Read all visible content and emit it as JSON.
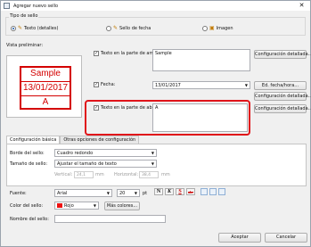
{
  "window": {
    "title": "Agregar nuevo sello",
    "close_glyph": "✕"
  },
  "stamp_type": {
    "label": "Tipo de sello",
    "options": [
      {
        "label": "Texto (detalles)",
        "icon": "text-stamp-icon",
        "glyph": "✎",
        "selected": true
      },
      {
        "label": "Sello de fecha",
        "icon": "date-stamp-icon",
        "glyph": "✎",
        "selected": false
      },
      {
        "label": "Imagen",
        "icon": "image-stamp-icon",
        "glyph": "▣",
        "selected": false
      }
    ]
  },
  "preview": {
    "label": "Vista preliminar:",
    "lines": [
      "Sample",
      "13/01/2017",
      "A"
    ],
    "color": "#d40000"
  },
  "top_text": {
    "checkbox_label": "Texto en la parte de arriba:",
    "checked": true,
    "value": "Sample",
    "detail_button": "Configuración detallada..."
  },
  "date": {
    "checkbox_label": "Fecha:",
    "checked": true,
    "value": "13/01/2017",
    "format_button": "Ed. fecha/hora...",
    "detail_button": "Configuración detallada..."
  },
  "bottom_text": {
    "checkbox_label": "Texto en la parte de abajo:",
    "checked": true,
    "value": "A",
    "detail_button": "Configuración detallada..."
  },
  "tabs": [
    {
      "label": "Configuración básica",
      "active": true
    },
    {
      "label": "Otras opciones de configuración",
      "active": false
    }
  ],
  "basic": {
    "border_label": "Borde del sello:",
    "border_value": "Cuadro redondo",
    "size_label": "Tamaño de sello:",
    "size_value": "Ajustar el tamaño de texto",
    "vertical_label": "Vertical:",
    "vertical_value": "24,1",
    "horizontal_label": "Horizontal:",
    "horizontal_value": "38,4",
    "unit": "mm",
    "font_label": "Fuente:",
    "font_value": "Arial",
    "font_size": "20",
    "font_size_unit": "pt",
    "format_buttons": [
      "N",
      "K",
      "S",
      "abc"
    ],
    "color_label": "Color del sello:",
    "color_value": "Rojo",
    "color_hex": "#e11111",
    "more_colors_button": "Más colores..."
  },
  "name": {
    "label": "Nombre del sello:",
    "value": ""
  },
  "footer": {
    "accept": "Aceptar",
    "cancel": "Cancelar"
  }
}
